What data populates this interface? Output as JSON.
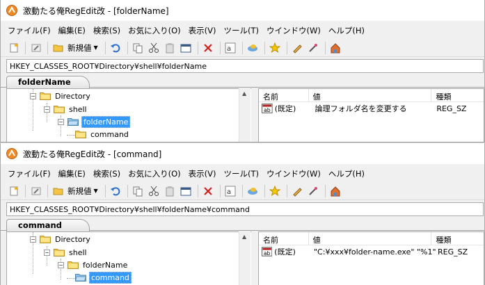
{
  "windows": [
    {
      "title": "激動たる俺RegEdit改 - [folderName]",
      "menu": [
        "ファイル(F)",
        "編集(E)",
        "検索(S)",
        "お気に入り(O)",
        "表示(V)",
        "ツール(T)",
        "ウインドウ(W)",
        "ヘルプ(H)"
      ],
      "toolbar": {
        "new_label": "新規値"
      },
      "address": "HKEY_CLASSES_ROOT¥Directory¥shell¥folderName",
      "tab": "folderName",
      "tree": [
        {
          "label": "Directory",
          "selected": false
        },
        {
          "label": "shell",
          "selected": false
        },
        {
          "label": "folderName",
          "selected": true
        },
        {
          "label": "command",
          "selected": false
        }
      ],
      "list": {
        "headers": [
          "名前",
          "値",
          "種類"
        ],
        "rows": [
          {
            "name": "(既定)",
            "value": "論理フォルダ名を変更する",
            "type": "REG_SZ"
          }
        ]
      }
    },
    {
      "title": "激動たる俺RegEdit改 - [command]",
      "menu": [
        "ファイル(F)",
        "編集(E)",
        "検索(S)",
        "お気に入り(O)",
        "表示(V)",
        "ツール(T)",
        "ウインドウ(W)",
        "ヘルプ(H)"
      ],
      "toolbar": {
        "new_label": "新規値"
      },
      "address": "HKEY_CLASSES_ROOT¥Directory¥shell¥folderName¥command",
      "tab": "command",
      "tree": [
        {
          "label": "Directory",
          "selected": false
        },
        {
          "label": "shell",
          "selected": false
        },
        {
          "label": "folderName",
          "selected": false
        },
        {
          "label": "command",
          "selected": true
        }
      ],
      "list": {
        "headers": [
          "名前",
          "値",
          "種類"
        ],
        "rows": [
          {
            "name": "(既定)",
            "value": "\"C:¥xxx¥folder-name.exe\" \"%1\"",
            "type": "REG_SZ"
          }
        ]
      }
    }
  ],
  "colors": {
    "selection": "#3399ff",
    "folder": "#f5c542",
    "open_folder": "#8fc3e8"
  }
}
